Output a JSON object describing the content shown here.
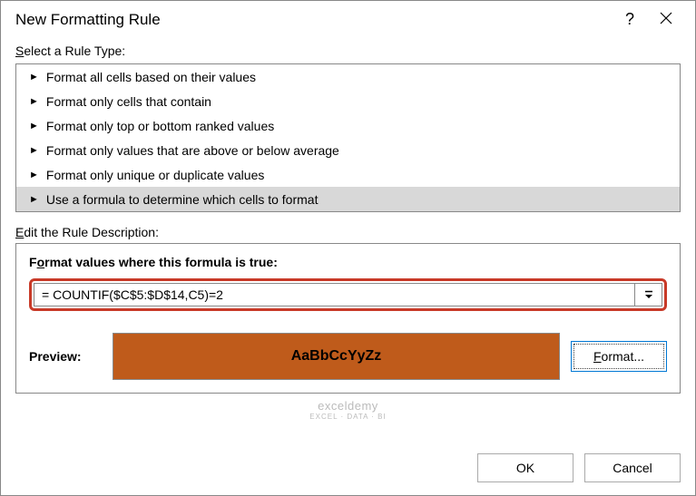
{
  "titlebar": {
    "title": "New Formatting Rule",
    "help": "?"
  },
  "sections": {
    "select_label_pre": "S",
    "select_label_rest": "elect a Rule Type:",
    "edit_label_pre": "E",
    "edit_label_rest": "dit the Rule Description:"
  },
  "rules": [
    {
      "label": "Format all cells based on their values",
      "selected": false
    },
    {
      "label": "Format only cells that contain",
      "selected": false
    },
    {
      "label": "Format only top or bottom ranked values",
      "selected": false
    },
    {
      "label": "Format only values that are above or below average",
      "selected": false
    },
    {
      "label": "Format only unique or duplicate values",
      "selected": false
    },
    {
      "label": "Use a formula to determine which cells to format",
      "selected": true
    }
  ],
  "formula": {
    "label_pre": "F",
    "label_u": "o",
    "label_rest": "rmat values where this formula is true:",
    "value": "= COUNTIF($C$5:$D$14,C5)=2"
  },
  "preview": {
    "label": "Preview:",
    "sample": "AaBbCcYyZz",
    "format_u": "F",
    "format_rest": "ormat..."
  },
  "footer": {
    "ok": "OK",
    "cancel": "Cancel"
  },
  "watermark": {
    "main": "exceldemy",
    "sub": "EXCEL · DATA · BI"
  }
}
